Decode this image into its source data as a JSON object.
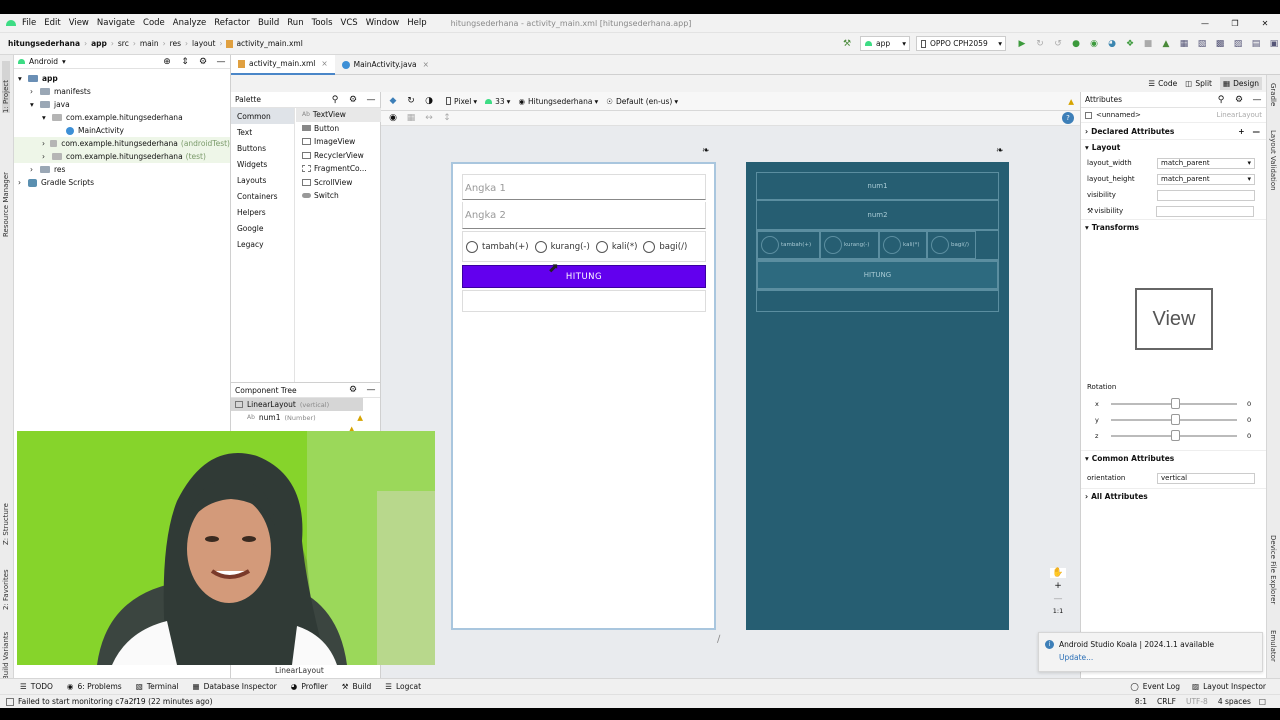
{
  "menu": [
    "File",
    "Edit",
    "View",
    "Navigate",
    "Code",
    "Analyze",
    "Refactor",
    "Build",
    "Run",
    "Tools",
    "VCS",
    "Window",
    "Help"
  ],
  "window_title": "hitungsederhana - activity_main.xml [hitungsederhana.app]",
  "breadcrumb": [
    "hitungsederhana",
    "app",
    "src",
    "main",
    "res",
    "layout",
    "activity_main.xml"
  ],
  "run_config": "app",
  "device": "OPPO CPH2059",
  "project_view": "Android",
  "tree": [
    {
      "label": "app",
      "bold": true
    },
    {
      "label": "manifests"
    },
    {
      "label": "java"
    },
    {
      "label": "com.example.hitungsederhana"
    },
    {
      "label": "MainActivity"
    },
    {
      "label": "com.example.hitungsederhana",
      "suffix": "(androidTest)"
    },
    {
      "label": "com.example.hitungsederhana",
      "suffix": "(test)"
    },
    {
      "label": "res"
    },
    {
      "label": "Gradle Scripts"
    }
  ],
  "editor_tabs": [
    "activity_main.xml",
    "MainActivity.java"
  ],
  "view_modes": [
    "Code",
    "Split",
    "Design"
  ],
  "palette": {
    "title": "Palette",
    "categories": [
      "Common",
      "Text",
      "Buttons",
      "Widgets",
      "Layouts",
      "Containers",
      "Helpers",
      "Google",
      "Legacy"
    ],
    "items": [
      "TextView",
      "Button",
      "ImageView",
      "RecyclerView",
      "FragmentCo...",
      "ScrollView",
      "Switch"
    ]
  },
  "design_toolbar": {
    "device": "Pixel",
    "api": "33",
    "theme": "Hitungsederhana",
    "locale": "Default (en-us)"
  },
  "component_tree": {
    "title": "Component Tree",
    "root": "LinearLayout",
    "root_suffix": "(vertical)",
    "child": "num1",
    "child_suffix": "(Number)"
  },
  "phone": {
    "hint1": "Angka 1",
    "hint2": "Angka 2",
    "radios": [
      "tambah(+)",
      "kurang(-)",
      "kali(*)",
      "bagi(/)"
    ],
    "button": "HITUNG"
  },
  "blueprint": {
    "f1": "num1",
    "f2": "num2",
    "radios": [
      "tambah(+)",
      "kurang(-)",
      "kali(*)",
      "bagi(/)"
    ],
    "button": "HITUNG"
  },
  "bottom_label": "LinearLayout",
  "attributes": {
    "title": "Attributes",
    "name": "<unnamed>",
    "type": "LinearLayout",
    "declared": "Declared Attributes",
    "layout_section": "Layout",
    "rows": [
      {
        "k": "layout_width",
        "v": "match_parent"
      },
      {
        "k": "layout_height",
        "v": "match_parent"
      },
      {
        "k": "visibility",
        "v": ""
      },
      {
        "k": "visibility",
        "v": ""
      }
    ],
    "transforms": "Transforms",
    "view_box": "View",
    "rotation": "Rotation",
    "axes": [
      {
        "k": "x",
        "v": "0"
      },
      {
        "k": "y",
        "v": "0"
      },
      {
        "k": "z",
        "v": "0"
      }
    ],
    "common": "Common Attributes",
    "orientation_k": "orientation",
    "orientation_v": "vertical",
    "all": "All Attributes"
  },
  "notification": {
    "title": "Android Studio Koala | 2024.1.1 available",
    "link": "Update..."
  },
  "zoom_label": "1:1",
  "bottom_tools": [
    "TODO",
    "6: Problems",
    "Terminal",
    "Database Inspector",
    "Profiler",
    "Build",
    "Logcat"
  ],
  "bottom_right_tools": [
    "Event Log",
    "Layout Inspector"
  ],
  "status_text": "Failed to start monitoring c7a2f19 (22 minutes ago)",
  "status_right": [
    "8:1",
    "CRLF",
    "UTF-8",
    "4 spaces"
  ],
  "left_strip": [
    "1: Project",
    "Resource Manager",
    "Z: Structure",
    "2: Favorites",
    "Build Variants"
  ],
  "right_strip": [
    "Gradle",
    "Layout Validation",
    "Device File Explorer",
    "Emulator"
  ],
  "colors": {
    "accent": "#6200ee",
    "blueprint": "#265e72"
  }
}
